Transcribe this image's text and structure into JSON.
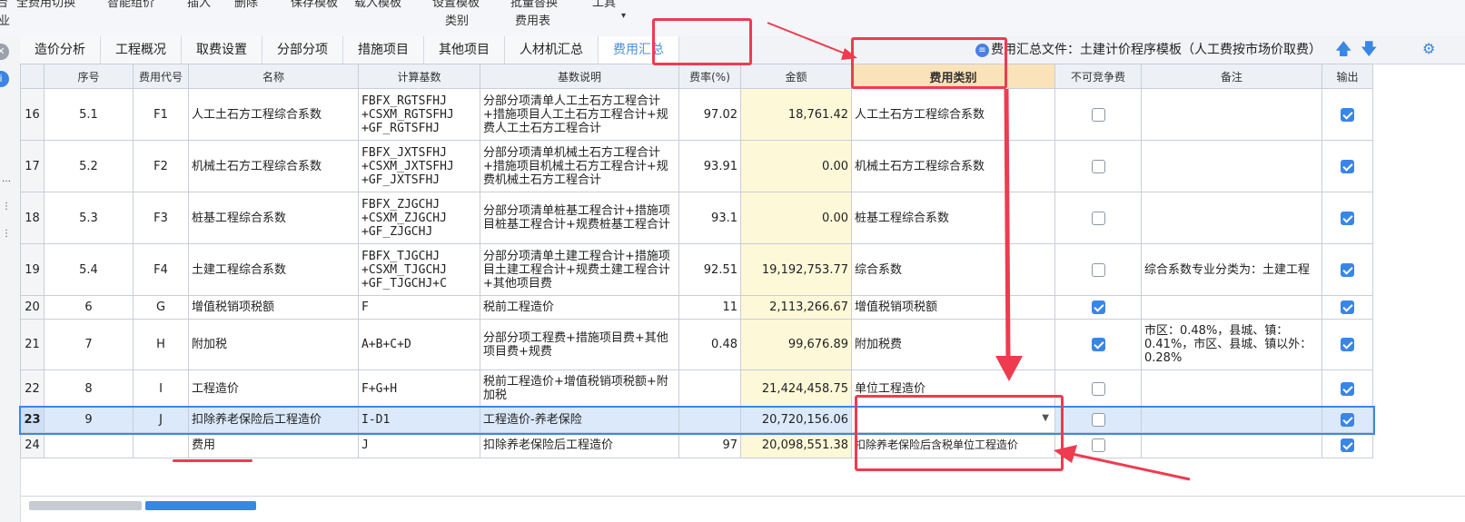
{
  "toolbar": {
    "items_cut": [
      "全费用切换",
      "智能组价",
      "插入",
      "删除",
      "保存模板",
      "载入模板",
      "设置模板",
      "批量替换",
      "工具"
    ],
    "items_low": [
      "类别",
      "费用表"
    ],
    "left_fragments": [
      "台",
      "业"
    ]
  },
  "tabs": [
    {
      "label": "造价分析",
      "active": false
    },
    {
      "label": "工程概况",
      "active": false
    },
    {
      "label": "取费设置",
      "active": false
    },
    {
      "label": "分部分项",
      "active": false
    },
    {
      "label": "措施项目",
      "active": false
    },
    {
      "label": "其他项目",
      "active": false
    },
    {
      "label": "人材机汇总",
      "active": false
    },
    {
      "label": "费用汇总",
      "active": true
    }
  ],
  "file_info": "费用汇总文件：土建计价程序模板（人工费按市场价取费）",
  "columns": [
    "",
    "序号",
    "费用代号",
    "名称",
    "计算基数",
    "基数说明",
    "费率(%)",
    "金额",
    "费用类别",
    "不可竞争费",
    "备注",
    "输出"
  ],
  "rows": [
    {
      "rn": "16",
      "seq": "5.1",
      "code": "F1",
      "name": "人工土石方工程综合系数",
      "base": [
        "FBFX_RGTSFHJ",
        "+CSXM_RGTSFHJ",
        "+GF_RGTSFHJ"
      ],
      "desc": "分部分项清单人工土石方工程合计+措施项目人工土石方工程合计+规费人工土石方工程合计",
      "rate": "97.02",
      "amount": "18,761.42",
      "category": "人工土石方工程综合系数",
      "noncomp": false,
      "note": "",
      "output": true
    },
    {
      "rn": "17",
      "seq": "5.2",
      "code": "F2",
      "name": "机械土石方工程综合系数",
      "base": [
        "FBFX_JXTSFHJ",
        "+CSXM_JXTSFHJ",
        "+GF_JXTSFHJ"
      ],
      "desc": "分部分项清单机械土石方工程合计+措施项目机械土石方工程合计+规费机械土石方工程合计",
      "rate": "93.91",
      "amount": "0.00",
      "category": "机械土石方工程综合系数",
      "noncomp": false,
      "note": "",
      "output": true
    },
    {
      "rn": "18",
      "seq": "5.3",
      "code": "F3",
      "name": "桩基工程综合系数",
      "base": [
        "FBFX_ZJGCHJ",
        "+CSXM_ZJGCHJ",
        "+GF_ZJGCHJ"
      ],
      "desc": "分部分项清单桩基工程合计+措施项目桩基工程合计+规费桩基工程合计",
      "rate": "93.1",
      "amount": "0.00",
      "category": "桩基工程综合系数",
      "noncomp": false,
      "note": "",
      "output": true
    },
    {
      "rn": "19",
      "seq": "5.4",
      "code": "F4",
      "name": "土建工程综合系数",
      "base": [
        "FBFX_TJGCHJ",
        "+CSXM_TJGCHJ",
        "+GF_TJGCHJ+C"
      ],
      "desc": "分部分项清单土建工程合计+措施项目土建工程合计+规费土建工程合计+其他项目费",
      "rate": "92.51",
      "amount": "19,192,753.77",
      "category": "综合系数",
      "noncomp": false,
      "note": "综合系数专业分类为：土建工程",
      "output": true
    },
    {
      "rn": "20",
      "seq": "6",
      "code": "G",
      "name": "增值税销项税额",
      "base": [
        "F"
      ],
      "desc": "税前工程造价",
      "rate": "11",
      "amount": "2,113,266.67",
      "category": "增值税销项税额",
      "noncomp": true,
      "note": "",
      "output": true
    },
    {
      "rn": "21",
      "seq": "7",
      "code": "H",
      "name": "附加税",
      "base": [
        "A+B+C+D"
      ],
      "desc": "分部分项工程费+措施项目费+其他项目费+规费",
      "rate": "0.48",
      "amount": "99,676.89",
      "category": "附加税费",
      "noncomp": true,
      "note": "市区：0.48%，县城、镇：0.41%，市区、县城、镇以外：0.28%",
      "output": true
    },
    {
      "rn": "22",
      "seq": "8",
      "code": "I",
      "name": "工程造价",
      "base": [
        "F+G+H"
      ],
      "desc": "税前工程造价+增值税销项税额+附加税",
      "rate": "",
      "amount": "21,424,458.75",
      "category": "单位工程造价",
      "noncomp": false,
      "note": "",
      "output": true
    },
    {
      "rn": "23",
      "seq": "9",
      "code": "J",
      "name": "扣除养老保险后工程造价",
      "base": [
        "I-D1"
      ],
      "desc": "工程造价-养老保险",
      "rate": "",
      "amount": "20,720,156.06",
      "category": "",
      "noncomp": false,
      "note": "",
      "output": true,
      "selected": true
    },
    {
      "rn": "24",
      "seq": "",
      "code": "",
      "name": "费用",
      "base": [
        "J"
      ],
      "desc": "扣除养老保险后工程造价",
      "rate": "97",
      "amount": "20,098,551.38",
      "category": "扣除养老保险后含税单位工程造价",
      "noncomp": false,
      "note": "",
      "output": true
    }
  ],
  "colors": {
    "accent": "#3a86e6",
    "annotation": "#ee3b4f",
    "amount_bg": "#fdf8d8",
    "header_highlight": "#fbe3b9"
  }
}
